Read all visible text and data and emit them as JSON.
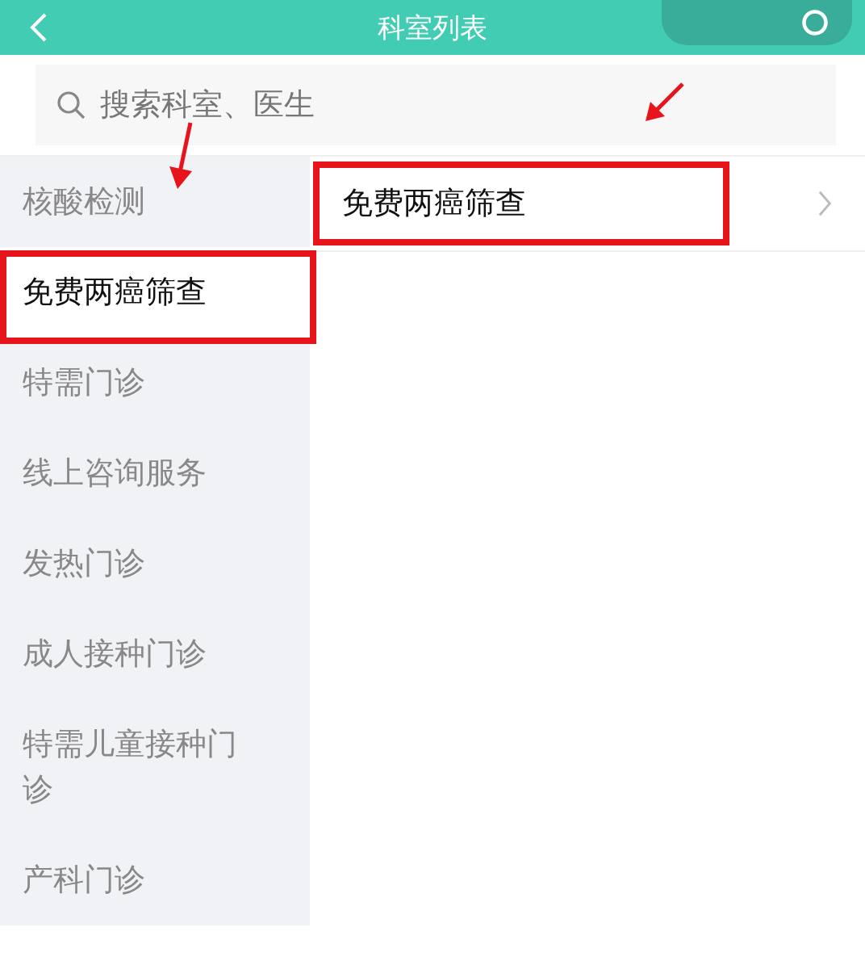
{
  "header": {
    "title": "科室列表"
  },
  "search": {
    "placeholder": "搜索科室、医生"
  },
  "departments": [
    {
      "label": "核酸检测",
      "selected": false
    },
    {
      "label": "免费两癌筛查",
      "selected": true
    },
    {
      "label": "特需门诊",
      "selected": false
    },
    {
      "label": "线上咨询服务",
      "selected": false
    },
    {
      "label": "发热门诊",
      "selected": false
    },
    {
      "label": "成人接种门诊",
      "selected": false
    },
    {
      "label": "特需儿童接种门诊",
      "selected": false
    },
    {
      "label": "产科门诊",
      "selected": false
    }
  ],
  "sub_departments": [
    {
      "label": "免费两癌筛查"
    }
  ]
}
